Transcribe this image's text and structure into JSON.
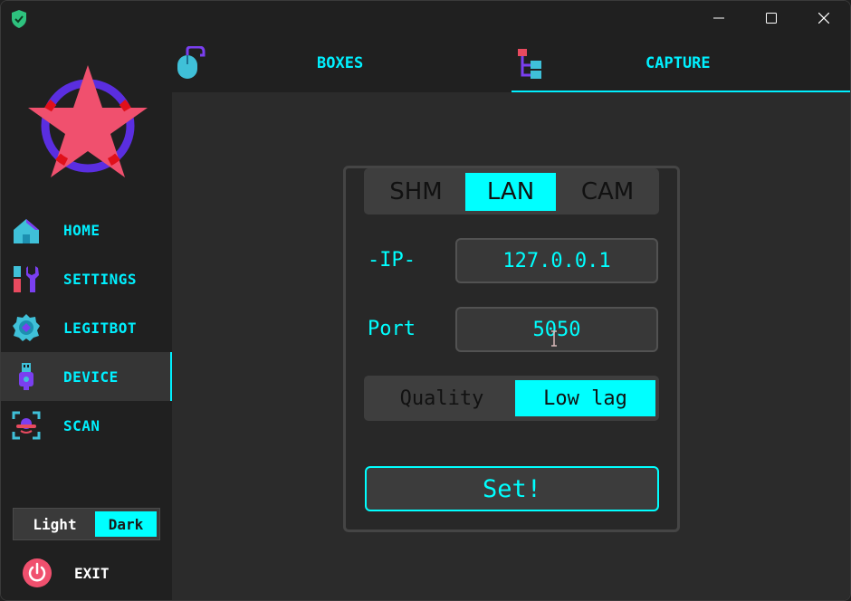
{
  "titlebar": {
    "app_icon": "shield-check-icon",
    "minimize_icon": "minimize-icon",
    "maximize_icon": "maximize-icon",
    "close_icon": "close-icon"
  },
  "sidebar": {
    "logo": "star-logo",
    "items": [
      {
        "label": "HOME",
        "icon": "home-icon"
      },
      {
        "label": "SETTINGS",
        "icon": "tools-icon"
      },
      {
        "label": "LEGITBOT",
        "icon": "robot-gear-icon"
      },
      {
        "label": "DEVICE",
        "icon": "usb-device-icon",
        "active": true
      },
      {
        "label": "SCAN",
        "icon": "scan-icon"
      }
    ],
    "theme": {
      "light_label": "Light",
      "dark_label": "Dark",
      "selected": "Dark"
    },
    "exit_label": "EXIT"
  },
  "tabs": [
    {
      "label": "BOXES",
      "icon": "mouse-icon"
    },
    {
      "label": "CAPTURE",
      "icon": "tree-icon",
      "active": true
    }
  ],
  "capture": {
    "source_options": [
      "SHM",
      "LAN",
      "CAM"
    ],
    "source_selected": "LAN",
    "ip_label": "-IP-",
    "ip_value": "127.0.0.1",
    "port_label": "Port",
    "port_value": "5050",
    "mode_options": [
      "Quality",
      "Low lag"
    ],
    "mode_selected": "Low lag",
    "set_label": "Set!"
  },
  "colors": {
    "accent": "#00ffff",
    "background": "#202020",
    "content": "#2b2b2b",
    "logo_star": "#f0506e",
    "logo_ring": "#5a2ee0"
  }
}
